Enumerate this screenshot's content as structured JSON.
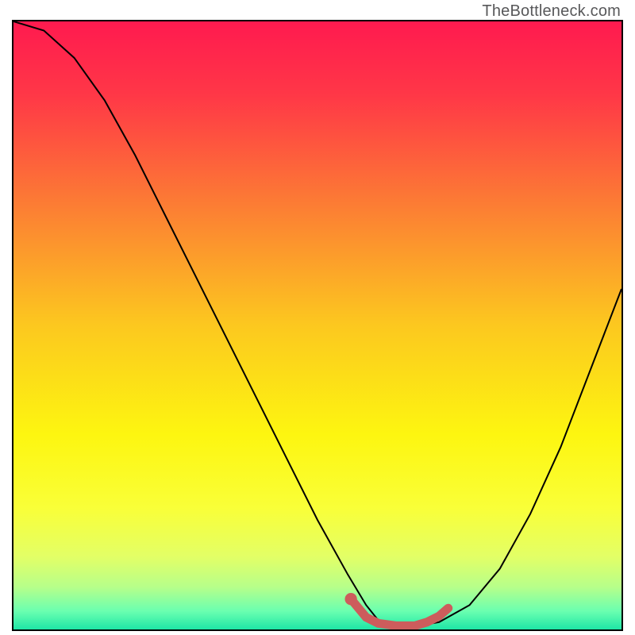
{
  "watermark": "TheBottleneck.com",
  "chart_data": {
    "type": "line",
    "title": "",
    "xlabel": "",
    "ylabel": "",
    "xlim": [
      0,
      100
    ],
    "ylim": [
      0,
      100
    ],
    "gradient_stops": [
      {
        "offset": 0.0,
        "color": "#ff1a4f"
      },
      {
        "offset": 0.12,
        "color": "#ff3747"
      },
      {
        "offset": 0.3,
        "color": "#fc7c34"
      },
      {
        "offset": 0.5,
        "color": "#fcc81f"
      },
      {
        "offset": 0.68,
        "color": "#fdf610"
      },
      {
        "offset": 0.8,
        "color": "#f9ff38"
      },
      {
        "offset": 0.88,
        "color": "#e3ff66"
      },
      {
        "offset": 0.93,
        "color": "#b7ff8a"
      },
      {
        "offset": 0.97,
        "color": "#6affb0"
      },
      {
        "offset": 1.0,
        "color": "#1ee6a6"
      }
    ],
    "series": [
      {
        "name": "bottleneck-curve",
        "color": "#000000",
        "x": [
          0,
          5,
          10,
          15,
          20,
          25,
          30,
          35,
          40,
          45,
          50,
          55,
          58,
          60,
          63,
          66,
          70,
          75,
          80,
          85,
          90,
          95,
          100
        ],
        "y": [
          100,
          98.5,
          94,
          87,
          78,
          68,
          58,
          48,
          38,
          28,
          18,
          9,
          4,
          1.5,
          0.5,
          0.5,
          1.2,
          4,
          10,
          19,
          30,
          43,
          56
        ]
      },
      {
        "name": "highlight-segment",
        "color": "#cd5c5c",
        "x": [
          55.5,
          58,
          60,
          63,
          66,
          68,
          70,
          71.5
        ],
        "y": [
          5.0,
          2.0,
          1.0,
          0.6,
          0.6,
          1.2,
          2.2,
          3.5
        ]
      }
    ],
    "highlight_marker": {
      "x": 55.5,
      "y": 5.0,
      "color": "#cd5c5c"
    }
  }
}
